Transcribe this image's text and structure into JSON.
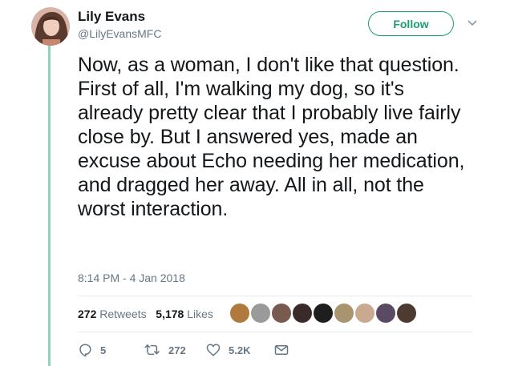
{
  "author": {
    "name": "Lily Evans",
    "handle": "@LilyEvansMFC",
    "avatar_icon": "profile-photo"
  },
  "follow_label": "Follow",
  "tweet_text": "Now, as a woman, I don't like that question. First of all, I'm walking my dog, so it's already pretty clear that I probably live fairly close by. But I answered yes, made an excuse about Echo needing her medication, and dragged her away. All in all, not the worst interaction.",
  "timestamp": "8:14 PM - 4 Jan 2018",
  "stats": {
    "retweets_count": "272",
    "retweets_label": "Retweets",
    "likes_count": "5,178",
    "likes_label": "Likes"
  },
  "actions": {
    "reply_count": "5",
    "retweet_count": "272",
    "like_count": "5.2K"
  },
  "colors": {
    "accent": "#1a9e72",
    "thread_line": "#8fd3b8",
    "secondary_text": "#657786"
  }
}
